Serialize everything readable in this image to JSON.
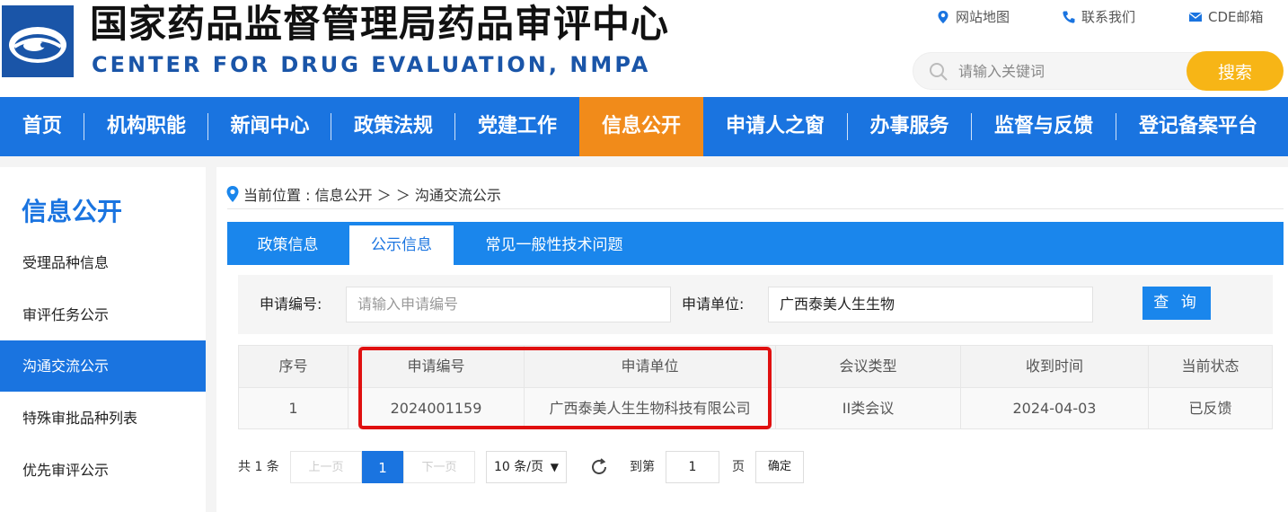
{
  "header": {
    "title_cn": "国家药品监督管理局药品审评中心",
    "title_en": "CENTER FOR DRUG EVALUATION, NMPA",
    "links": [
      {
        "label": "网站地图",
        "icon": "location-pin-icon"
      },
      {
        "label": "联系我们",
        "icon": "phone-icon"
      },
      {
        "label": "CDE邮箱",
        "icon": "mail-icon"
      }
    ],
    "search": {
      "placeholder": "请输入关键词",
      "button": "搜索"
    }
  },
  "nav": {
    "items": [
      "首页",
      "机构职能",
      "新闻中心",
      "政策法规",
      "党建工作",
      "信息公开",
      "申请人之窗",
      "办事服务",
      "监督与反馈",
      "登记备案平台"
    ],
    "active": "信息公开"
  },
  "sidebar": {
    "title": "信息公开",
    "items": [
      "受理品种信息",
      "审评任务公示",
      "沟通交流公示",
      "特殊审批品种列表",
      "优先审评公示"
    ],
    "active": "沟通交流公示"
  },
  "main": {
    "breadcrumb": "当前位置 : 信息公开 ＞ ＞ 沟通交流公示",
    "tabs": [
      "政策信息",
      "公示信息",
      "常见一般性技术问题"
    ],
    "active_tab": "公示信息",
    "filter": {
      "label1": "申请编号:",
      "placeholder1": "请输入申请编号",
      "label2": "申请单位:",
      "value2": "广西泰美人生生物",
      "button": "查 询"
    },
    "table": {
      "headers": [
        "序号",
        "申请编号",
        "申请单位",
        "会议类型",
        "收到时间",
        "当前状态"
      ],
      "rows": [
        [
          "1",
          "2024001159",
          "广西泰美人生生物科技有限公司",
          "II类会议",
          "2024-04-03",
          "已反馈"
        ]
      ]
    },
    "pager": {
      "total": "共 1 条",
      "prev": "上一页",
      "current": "1",
      "next": "下一页",
      "per_page": "10 条/页",
      "goto_label": "到第",
      "goto_value": "1",
      "page_unit": "页",
      "confirm": "确定"
    }
  },
  "colors": {
    "primary": "#1a74e0",
    "active_nav": "#f18b1a",
    "search_button": "#f7b516",
    "highlight": "#e01010"
  }
}
